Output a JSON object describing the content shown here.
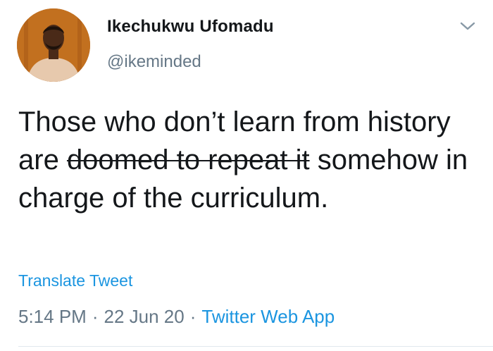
{
  "tweet": {
    "display_name": "Ikechukwu Ufomadu",
    "handle": "@ikeminded",
    "text_part1": "Those who don’t learn from history are ",
    "text_struck": "doomed to repeat it",
    "text_part2": " somehow in charge of the curriculum.",
    "translate_label": "Translate Tweet",
    "time": "5:14 PM",
    "separator": "·",
    "date": "22 Jun 20",
    "source": "Twitter Web App"
  },
  "icons": {
    "avatar": "profile-photo",
    "menu": "chevron-down-icon"
  },
  "colors": {
    "text": "#14171a",
    "secondary": "#657786",
    "link": "#1b95e0",
    "divider": "#e1e8ed"
  }
}
